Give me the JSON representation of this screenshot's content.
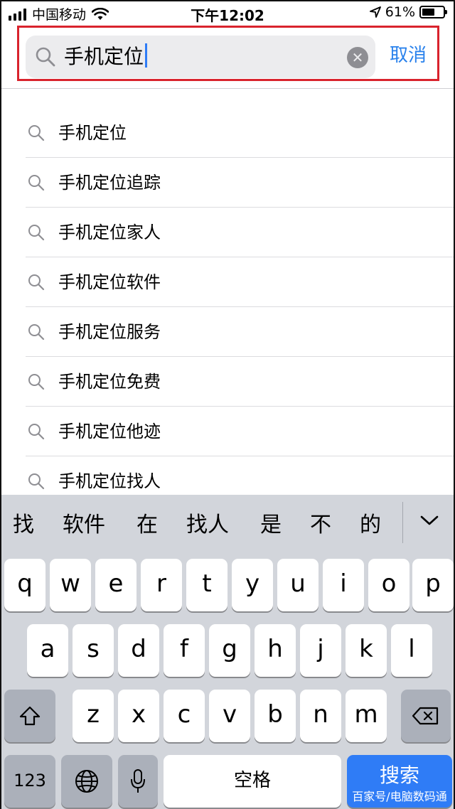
{
  "status_bar": {
    "carrier": "中国移动",
    "time": "下午12:02",
    "battery_percent": "61%",
    "battery_level": 0.61,
    "icons": [
      "signal-icon",
      "wifi-icon",
      "location-arrow-icon",
      "battery-icon"
    ]
  },
  "search": {
    "value": "手机定位",
    "cancel_label": "取消",
    "clear_icon": "clear-icon",
    "search_icon": "search-icon",
    "highlight_color": "#d9232d"
  },
  "suggestions": [
    "手机定位",
    "手机定位追踪",
    "手机定位家人",
    "手机定位软件",
    "手机定位服务",
    "手机定位免费",
    "手机定位他迹",
    "手机定位找人"
  ],
  "keyboard": {
    "candidates": [
      "找",
      "软件",
      "在",
      "找人",
      "是",
      "不",
      "的"
    ],
    "row1": [
      "q",
      "w",
      "e",
      "r",
      "t",
      "y",
      "u",
      "i",
      "o",
      "p"
    ],
    "row2": [
      "a",
      "s",
      "d",
      "f",
      "g",
      "h",
      "j",
      "k",
      "l"
    ],
    "row3": [
      "z",
      "x",
      "c",
      "v",
      "b",
      "n",
      "m"
    ],
    "numbers_label": "123",
    "space_label": "空格",
    "search_label": "搜索",
    "watermark": "百家号/电脑数码通",
    "accent": "#2f7cf6"
  }
}
